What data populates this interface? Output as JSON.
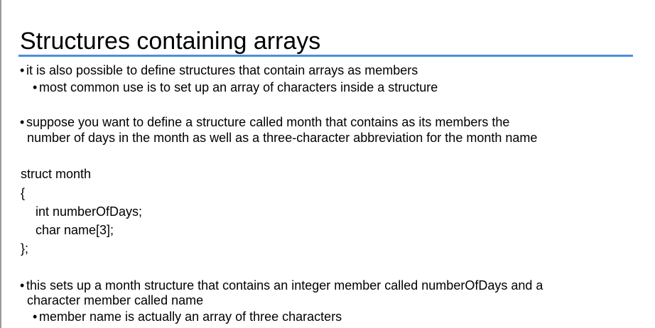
{
  "slide": {
    "title": "Structures containing arrays",
    "accent_color": "#4a90d9",
    "bullet_char": "•",
    "bullets": {
      "b1": "it is also possible to define structures that contain arrays as members",
      "b1_sub1": "most common use is to set up an array of characters inside a structure",
      "b2_line1": "suppose you want to define a structure called month that contains as its members the",
      "b2_line2": "number of days in the month as well as a three-character abbreviation for the month name",
      "b3_line1": "this sets up a month structure that contains an integer member called numberOfDays and a",
      "b3_line2": "character member called name",
      "b3_sub1": "member name is actually an array of three characters"
    },
    "code": {
      "line1": "struct  month",
      "line2": "{",
      "line3": "int    numberOfDays;",
      "line4": "char   name[3];",
      "line5": "};"
    }
  }
}
